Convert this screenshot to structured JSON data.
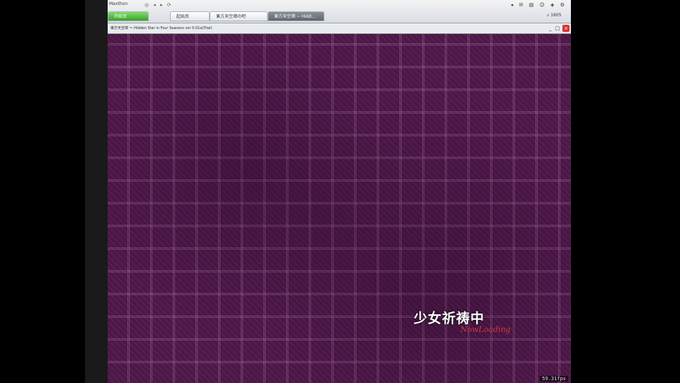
{
  "browser": {
    "menu_label": "Maxthon",
    "toolbar_icons": "◎ ◂ ▸ ⟳",
    "tray_icons": "◂ ✉ ▤ ☺ ◈ ⚙",
    "search_label": "⌕ 1605",
    "tabs": [
      {
        "label": "开始页"
      },
      {
        "label": "起始页"
      },
      {
        "label": "東方天空璋の吧"
      },
      {
        "label": "東方天空璋 ~ Hidd..."
      }
    ]
  },
  "window": {
    "title": "東方天空璋 ～ Hidden Star in Four Seasons  ver 0.01a(Trial)",
    "min": "_",
    "max": "□",
    "close": "×"
  },
  "game": {
    "loading_text": "少女祈祷中",
    "loading_subtext": "NowLoading",
    "fps": "59.31fps"
  }
}
